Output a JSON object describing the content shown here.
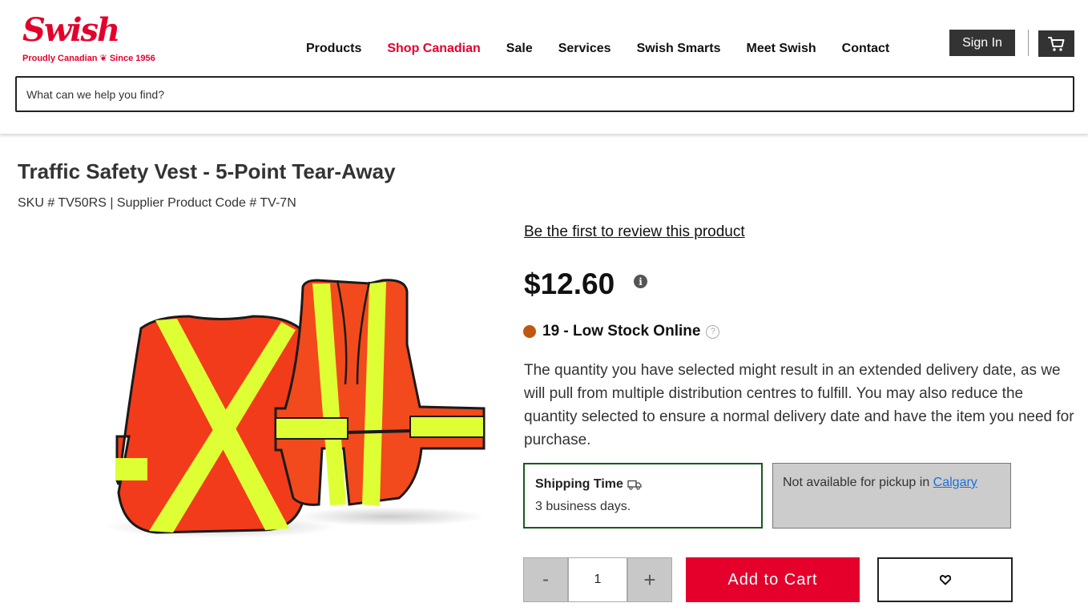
{
  "brand": {
    "name": "Swish",
    "tagline": "Proudly Canadian ❦ Since 1956",
    "accent_color": "#e4002b"
  },
  "nav": {
    "items": [
      {
        "label": "Products"
      },
      {
        "label": "Shop Canadian"
      },
      {
        "label": "Sale"
      },
      {
        "label": "Services"
      },
      {
        "label": "Swish Smarts"
      },
      {
        "label": "Meet Swish"
      },
      {
        "label": "Contact"
      }
    ],
    "active_index": 1
  },
  "header": {
    "sign_in_label": "Sign In",
    "cart_icon": "cart-icon"
  },
  "search": {
    "placeholder": "What can we help you find?",
    "value": ""
  },
  "product": {
    "title": "Traffic Safety Vest - 5-Point Tear-Away",
    "sku_line": "SKU # TV50RS | Supplier Product Code # TV-7N",
    "review_link": "Be the first to review this product",
    "price": "$12.60",
    "price_info_icon": "info-icon",
    "stock_text": "19 - Low Stock Online",
    "stock_color": "#c05811",
    "stock_help_icon": "help-icon",
    "notice": "The quantity you have selected might result in an extended delivery date, as we will pull from multiple distribution centres to fulfill. You may also reduce the quantity selected to ensure a normal delivery date and have the item you need for purchase."
  },
  "shipping": {
    "title": "Shipping Time",
    "icon": "truck-icon",
    "days": "3 business days.",
    "border_color": "#1a5a1a"
  },
  "pickup": {
    "text": "Not available for pickup in ",
    "location": "Calgary"
  },
  "purchase": {
    "minus_label": "-",
    "quantity": "1",
    "plus_label": "+",
    "add_to_cart_label": "Add to Cart",
    "wishlist_icon": "heart-icon"
  }
}
